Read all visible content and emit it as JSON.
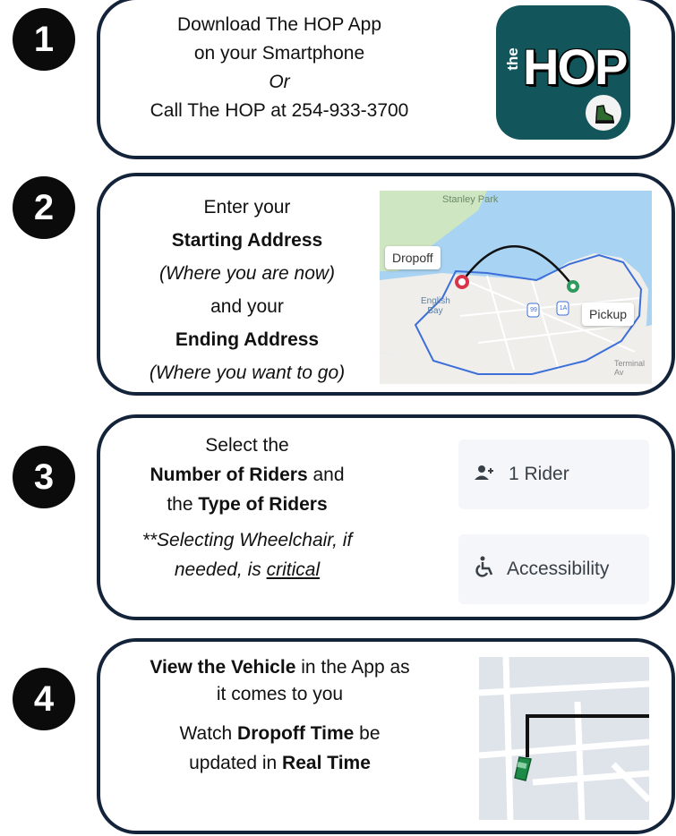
{
  "steps": [
    {
      "number": "1",
      "lines": [
        "Download The HOP App",
        "on your Smartphone",
        "Or",
        "Call The HOP at 254-933-3700"
      ],
      "logo": {
        "small_text": "the",
        "big_text": "HOP",
        "icon": "walking-shoe-icon",
        "bg": "#12555a"
      }
    },
    {
      "number": "2",
      "lines": [
        "Enter your",
        "Starting Address",
        "(Where you are now)",
        "and your",
        "Ending Address",
        "(Where you want to go)"
      ],
      "map": {
        "park": "Stanley Park",
        "dropoff": "Dropoff",
        "pickup": "Pickup",
        "bay": "English Bay",
        "shield1": "99",
        "shield2": "1A",
        "road": "Terminal Av"
      }
    },
    {
      "number": "3",
      "lines": [
        "Select the",
        "Number of Riders",
        " and",
        "the ",
        "Type of Riders",
        "**Selecting Wheelchair, if",
        "needed, is ",
        "critical"
      ],
      "options": [
        {
          "icon": "add-rider-icon",
          "label": "1 Rider"
        },
        {
          "icon": "wheelchair-icon",
          "label": "Accessibility"
        }
      ]
    },
    {
      "number": "4",
      "lines": [
        "View the Vehicle",
        " in the App as",
        "it comes to you",
        "Watch ",
        "Dropoff Time",
        " be",
        "updated in ",
        "Real Time"
      ]
    }
  ],
  "colors": {
    "card_border": "#13233a",
    "map_water": "#a9d3f2",
    "map_land": "#eeeeea",
    "route_red": "#d9344a",
    "route_green": "#2e9a5e"
  }
}
